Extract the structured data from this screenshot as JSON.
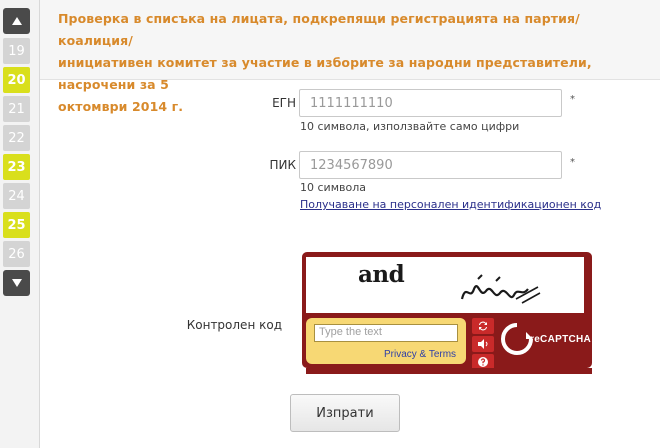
{
  "daynav": {
    "up_icon": "triangle-up-icon",
    "down_icon": "triangle-down-icon",
    "days": [
      {
        "label": "19",
        "state": "inactive"
      },
      {
        "label": "20",
        "state": "active"
      },
      {
        "label": "21",
        "state": "inactive"
      },
      {
        "label": "22",
        "state": "inactive"
      },
      {
        "label": "23",
        "state": "active"
      },
      {
        "label": "24",
        "state": "inactive"
      },
      {
        "label": "25",
        "state": "active"
      },
      {
        "label": "26",
        "state": "inactive"
      }
    ]
  },
  "header": {
    "title_line1": "Проверка в списъка на лицата, подкрепящи регистрацията на партия/коалиция/",
    "title_line2": "инициативен комитет за участие в изборите за народни представители, насрочени за 5",
    "title_line3": "октомври 2014 г."
  },
  "form": {
    "egn": {
      "label": "ЕГН",
      "placeholder": "1111111110",
      "required_mark": "*",
      "hint": "10 символа, използвайте само цифри"
    },
    "pik": {
      "label": "ПИК",
      "placeholder": "1234567890",
      "required_mark": "*",
      "hint": "10 символа",
      "link": "Получаване на персонален идентификационен код",
      "link_suffix": "."
    },
    "captcha": {
      "label": "Контролен код",
      "word": "and",
      "input_placeholder": "Type the text",
      "privacy": "Privacy & Terms",
      "logo": "reCAPTCHA"
    },
    "submit_label": "Изпрати"
  },
  "colors": {
    "header_text": "#d88a2c",
    "day_active": "#d9df1c",
    "day_inactive": "#d4d4d4",
    "recaptcha_red": "#8a1a1a",
    "recaptcha_yellow": "#f7d874",
    "link": "#2a2f8a"
  }
}
